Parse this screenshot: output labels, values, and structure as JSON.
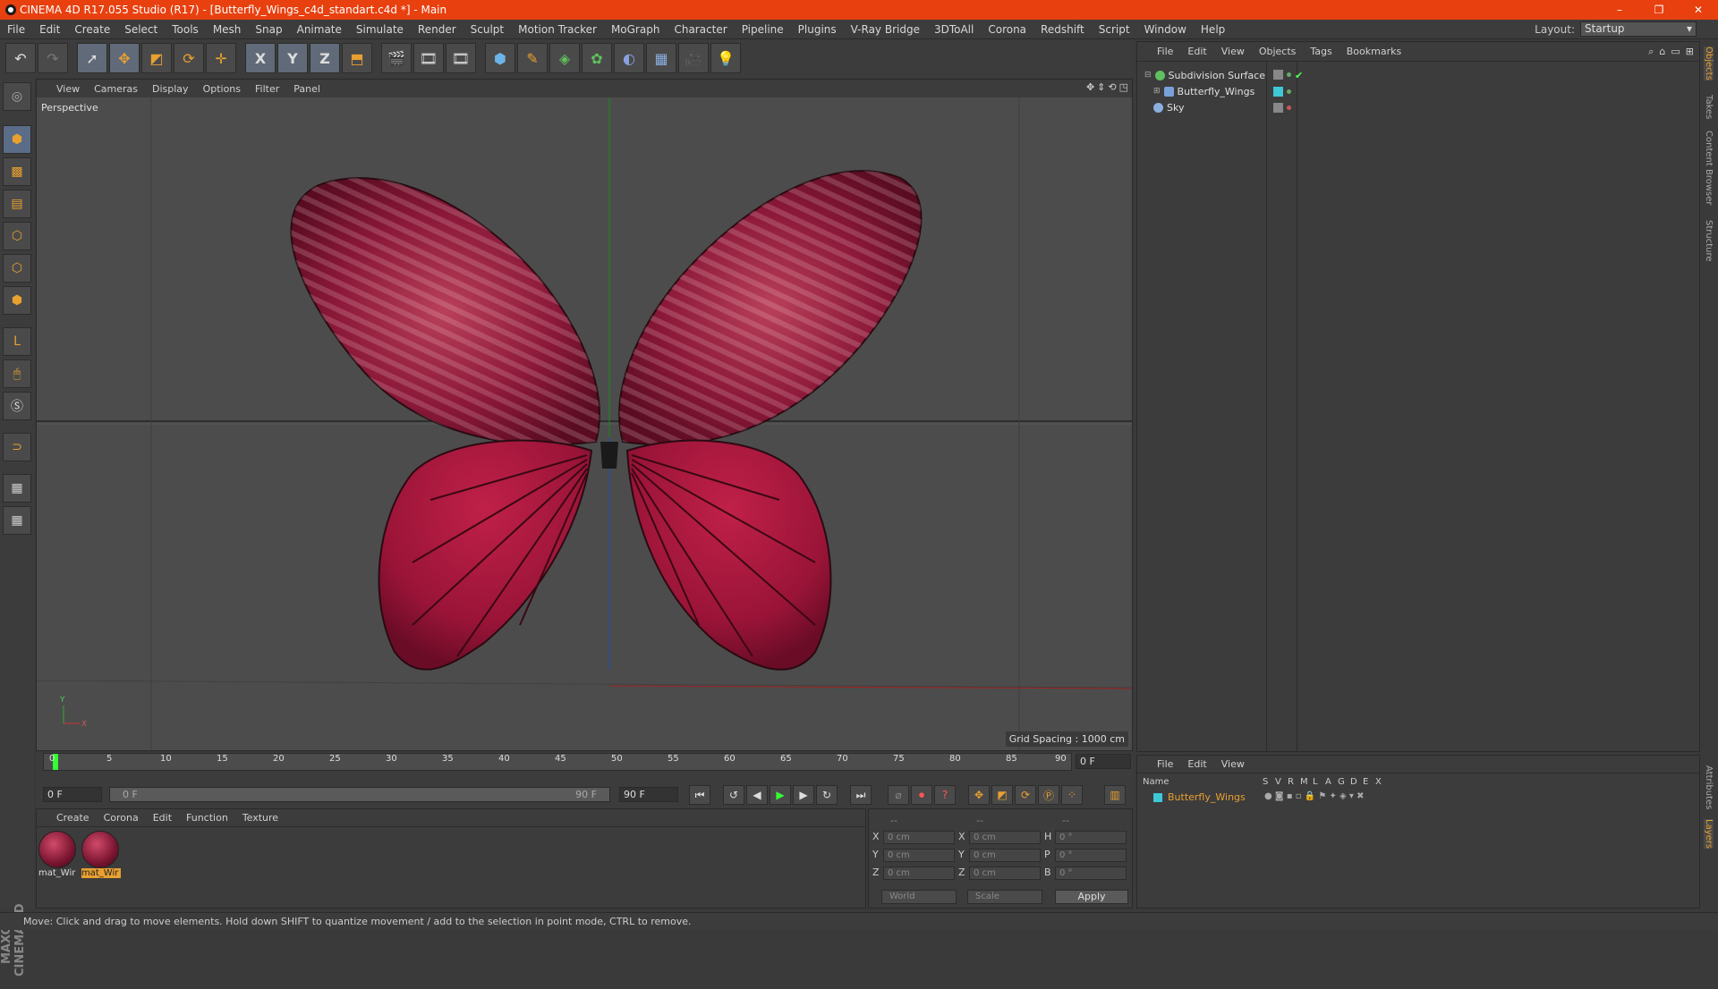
{
  "window": {
    "title": "CINEMA 4D R17.055 Studio (R17) - [Butterfly_Wings_c4d_standart.c4d *] - Main",
    "buttons": [
      "–",
      "❐",
      "✕"
    ]
  },
  "menubar": {
    "items": [
      "File",
      "Edit",
      "Create",
      "Select",
      "Tools",
      "Mesh",
      "Snap",
      "Animate",
      "Simulate",
      "Render",
      "Sculpt",
      "Motion Tracker",
      "MoGraph",
      "Character",
      "Pipeline",
      "Plugins",
      "V-Ray Bridge",
      "3DToAll",
      "Corona",
      "Redshift",
      "Script",
      "Window",
      "Help"
    ],
    "layout_label": "Layout:",
    "layout_value": "Startup"
  },
  "toolbar": {
    "axis_x": "X",
    "axis_y": "Y",
    "axis_z": "Z"
  },
  "viewport": {
    "menu": [
      "View",
      "Cameras",
      "Display",
      "Options",
      "Filter",
      "Panel"
    ],
    "camera_label": "Perspective",
    "grid_spacing": "Grid Spacing : 1000 cm",
    "axis_y": "Y",
    "axis_x": "X"
  },
  "object_manager": {
    "menu": [
      "File",
      "Edit",
      "View",
      "Objects",
      "Tags",
      "Bookmarks"
    ],
    "objects": [
      {
        "name": "Subdivision Surface",
        "color": "#5fc05f"
      },
      {
        "name": "Butterfly_Wings",
        "color": "#7aa0d8"
      },
      {
        "name": "Sky",
        "color": "#8ab0e0"
      }
    ]
  },
  "side_tabs": [
    "Objects",
    "Takes",
    "Content Browser",
    "Structure",
    "Attributes",
    "Layers"
  ],
  "timeline": {
    "ticks": [
      "0",
      "5",
      "10",
      "15",
      "20",
      "25",
      "30",
      "35",
      "40",
      "45",
      "50",
      "55",
      "60",
      "65",
      "70",
      "75",
      "80",
      "85",
      "90"
    ],
    "current_frame": "0 F"
  },
  "transport": {
    "start": "0 F",
    "range_start": "0 F",
    "range_end": "90 F",
    "end": "90 F"
  },
  "material_manager": {
    "menu": [
      "Create",
      "Corona",
      "Edit",
      "Function",
      "Texture"
    ],
    "materials": [
      {
        "label": "mat_Wir"
      },
      {
        "label": "mat_Wir"
      }
    ]
  },
  "coordinates": {
    "headers": [
      "--",
      "--",
      "--"
    ],
    "rows": [
      {
        "a": "X",
        "av": "0 cm",
        "b": "X",
        "bv": "0 cm",
        "c": "H",
        "cv": "0 °"
      },
      {
        "a": "Y",
        "av": "0 cm",
        "b": "Y",
        "bv": "0 cm",
        "c": "P",
        "cv": "0 °"
      },
      {
        "a": "Z",
        "av": "0 cm",
        "b": "Z",
        "bv": "0 cm",
        "c": "B",
        "cv": "0 °"
      }
    ],
    "space": "World",
    "mode": "Scale",
    "apply": "Apply"
  },
  "layer_manager": {
    "menu": [
      "File",
      "Edit",
      "View"
    ],
    "columns": [
      "Name",
      "S",
      "V",
      "R",
      "M",
      "L",
      "A",
      "G",
      "D",
      "E",
      "X"
    ],
    "layer_name": "Butterfly_Wings",
    "layer_color": "#3ec8d8"
  },
  "status": "Move: Click and drag to move elements. Hold down SHIFT to quantize movement / add to the selection in point mode, CTRL to remove.",
  "maxon": "MAXON CINEMA 4D"
}
